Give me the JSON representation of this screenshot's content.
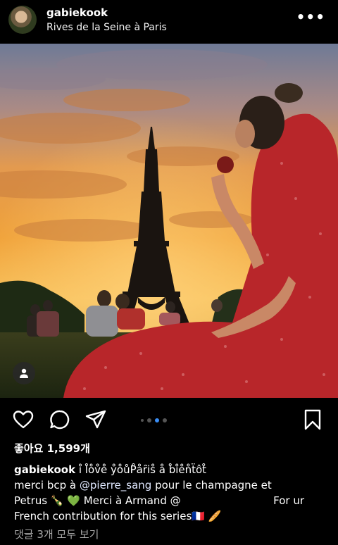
{
  "post": {
    "username": "gabiekook",
    "location": "Rives de la Seine à Paris",
    "more_icon": "more-icon"
  },
  "actions": {
    "like_icon": "heart-icon",
    "comment_icon": "comment-icon",
    "share_icon": "share-icon",
    "save_icon": "bookmark-icon",
    "carousel_index": 2,
    "carousel_count": 4
  },
  "likes_text": "좋아요 1,599개",
  "caption": {
    "username": "gabiekook",
    "line1": "i̊ l̊o̊v̊e̊ ẙo̊ůP̊åȓis̊ å b̊i̊e̊n̊ẗôt̊",
    "line2_before": "merci bcp à ",
    "mention": "@pierre_sang",
    "line2_after": " pour le champagne et",
    "line3_a": "Petrus 🍾 💚  Merci à Armand @",
    "line3_b": "For ur",
    "line4": "French contribution for this series🇫🇷 🥖"
  },
  "comments_text": "댓글 3개 모두 보기"
}
